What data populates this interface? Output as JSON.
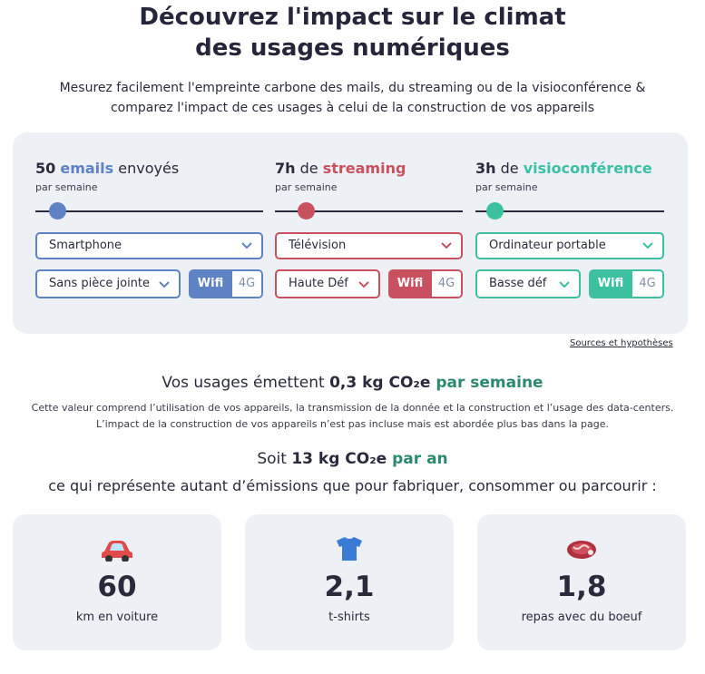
{
  "header": {
    "title_line1": "Découvrez l'impact sur le climat",
    "title_line2": "des usages numériques",
    "subtitle_line1": "Mesurez facilement l'empreinte carbone des mails, du streaming ou de la visioconférence &",
    "subtitle_line2": "comparez l'impact de ces usages à celui de la construction de vos appareils"
  },
  "colors": {
    "email": "#5f82c4",
    "streaming": "#c9515f",
    "visio": "#3cc0a0",
    "accent_text": "#2b8a6e"
  },
  "controls": {
    "email": {
      "amount": "50",
      "keyword": "emails",
      "suffix": " envoyés",
      "per": "par semaine",
      "slider_fraction": 0.06,
      "device": "Smartphone",
      "option": "Sans pièce jointe",
      "toggle_on": "Wifi",
      "toggle_off": "4G"
    },
    "streaming": {
      "amount": "7h",
      "prefix": " de ",
      "keyword": "streaming",
      "per": "par semaine",
      "slider_fraction": 0.12,
      "device": "Télévision",
      "option": "Haute Déf",
      "toggle_on": "Wifi",
      "toggle_off": "4G"
    },
    "visio": {
      "amount": "3h",
      "prefix": " de ",
      "keyword": "visioconférence",
      "per": "par semaine",
      "slider_fraction": 0.06,
      "device": "Ordinateur portable",
      "option": "Basse déf",
      "toggle_on": "Wifi",
      "toggle_off": "4G"
    }
  },
  "sources_link": "Sources et hypothèses",
  "result": {
    "prefix": "Vos usages émettent ",
    "value": "0,3 kg CO₂e",
    "period": " par semaine",
    "explanation_line1": "Cette valeur comprend l’utilisation de vos appareils, la transmission de la donnée et la construction et l’usage des data-centers.",
    "explanation_line2": "L’impact de la construction de vos appareils n’est pas incluse mais est abordée plus bas dans la page."
  },
  "yearly": {
    "prefix": "Soit ",
    "value": "13 kg CO₂e",
    "period": " par an",
    "represent": "ce qui représente autant d’émissions que pour fabriquer, consommer ou parcourir :"
  },
  "equivalents": [
    {
      "icon": "car-icon",
      "value": "60",
      "label": "km en voiture"
    },
    {
      "icon": "tshirt-icon",
      "value": "2,1",
      "label": "t-shirts"
    },
    {
      "icon": "steak-icon",
      "value": "1,8",
      "label": "repas avec du boeuf"
    }
  ]
}
